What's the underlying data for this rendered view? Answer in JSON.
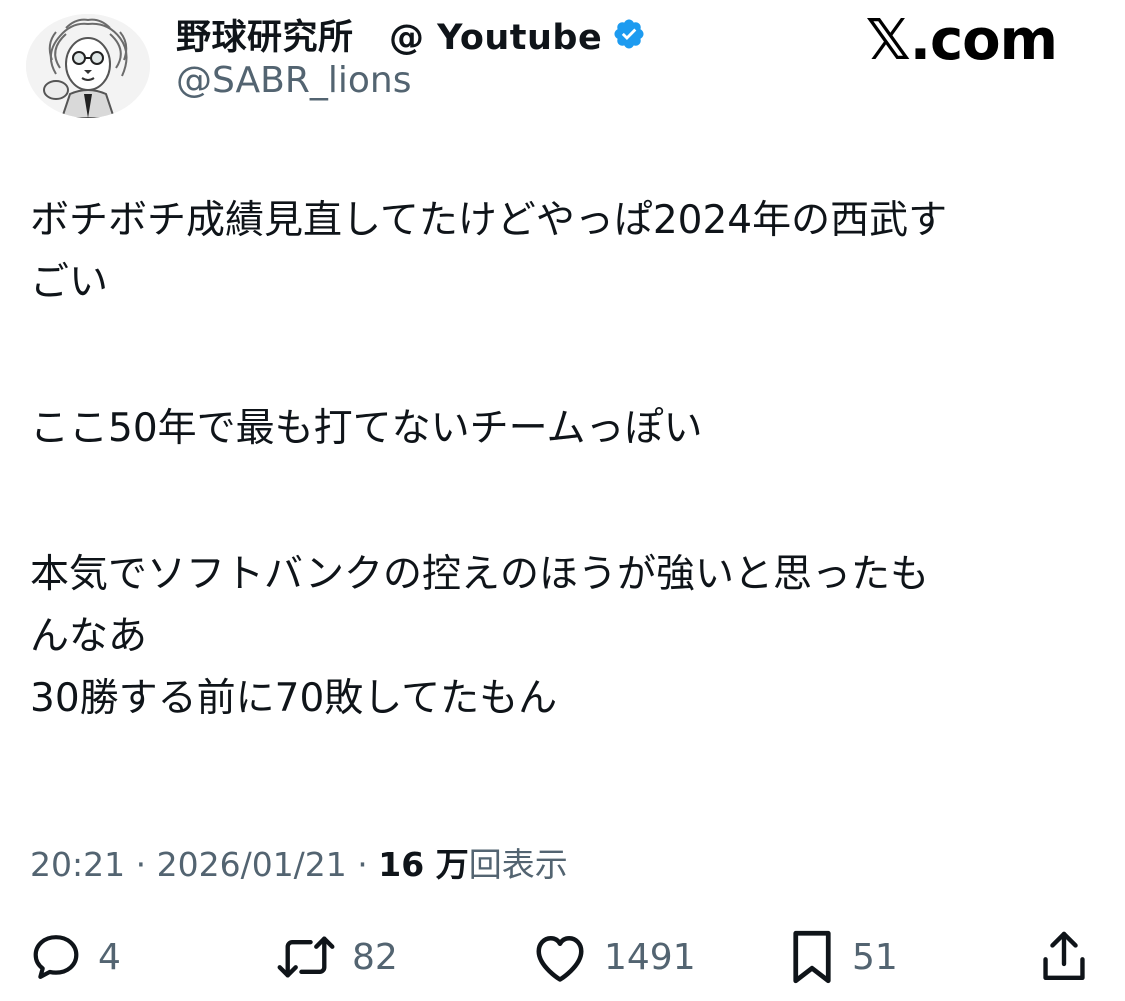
{
  "header": {
    "display_name": "野球研究所　@ Youtube",
    "handle": "@SABR_lions",
    "verified": true,
    "watermark": "𝕏.com"
  },
  "tweet": {
    "lines": [
      "ボチボチ成績見直してたけどやっぱ2024年の西武す",
      "ごい",
      "ここ50年で最も打てないチームっぽい",
      "本気でソフトバンクの控えのほうが強いと思ったも",
      "んなあ",
      "30勝する前に70敗してたもん"
    ]
  },
  "meta": {
    "time": "20:21",
    "date": "2026/01/21",
    "views_count": "16 万",
    "views_label": "回表示",
    "separator": " · "
  },
  "actions": {
    "reply_count": "4",
    "retweet_count": "82",
    "like_count": "1491",
    "bookmark_count": "51"
  },
  "colors": {
    "verified_badge": "#1d9bf0",
    "secondary_text": "#536471",
    "primary_text": "#0f1419"
  },
  "icons": [
    "avatar-lion-icon",
    "verified-badge-icon",
    "reply-icon",
    "retweet-icon",
    "like-icon",
    "bookmark-icon",
    "share-icon"
  ]
}
